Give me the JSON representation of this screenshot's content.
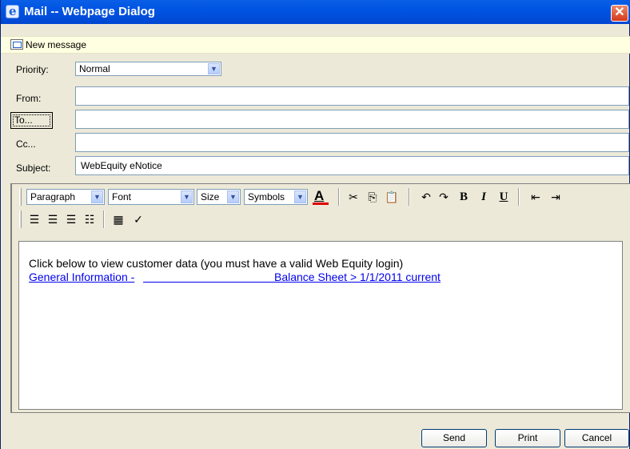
{
  "window": {
    "title": "Mail -- Webpage Dialog",
    "close_glyph": "✕"
  },
  "message_bar": {
    "label": "New message"
  },
  "form": {
    "priority_label": "Priority:",
    "priority_value": "Normal",
    "from_label": "From:",
    "from_value": "",
    "to_button": "To...",
    "to_value": "",
    "cc_label": "Cc...",
    "cc_value": "",
    "subject_label": "Subject:",
    "subject_value": "WebEquity eNotice"
  },
  "toolbar": {
    "paragraph": "Paragraph",
    "font": "Font",
    "size": "Size",
    "symbols": "Symbols",
    "font_color_glyph": "A",
    "bold": "B",
    "italic": "I",
    "underline": "U"
  },
  "body": {
    "line1": "Click below to view customer data (you must have a valid Web Equity login)",
    "link_part1": "General Information -",
    "link_part2": "Balance Sheet > 1/1/2011 current"
  },
  "buttons": {
    "send": "Send",
    "print": "Print",
    "cancel": "Cancel"
  },
  "colors": {
    "title_bar": "#0054e3",
    "dialog_bg": "#ece9d8",
    "font_color": "#e00000",
    "link": "#0000ee"
  }
}
